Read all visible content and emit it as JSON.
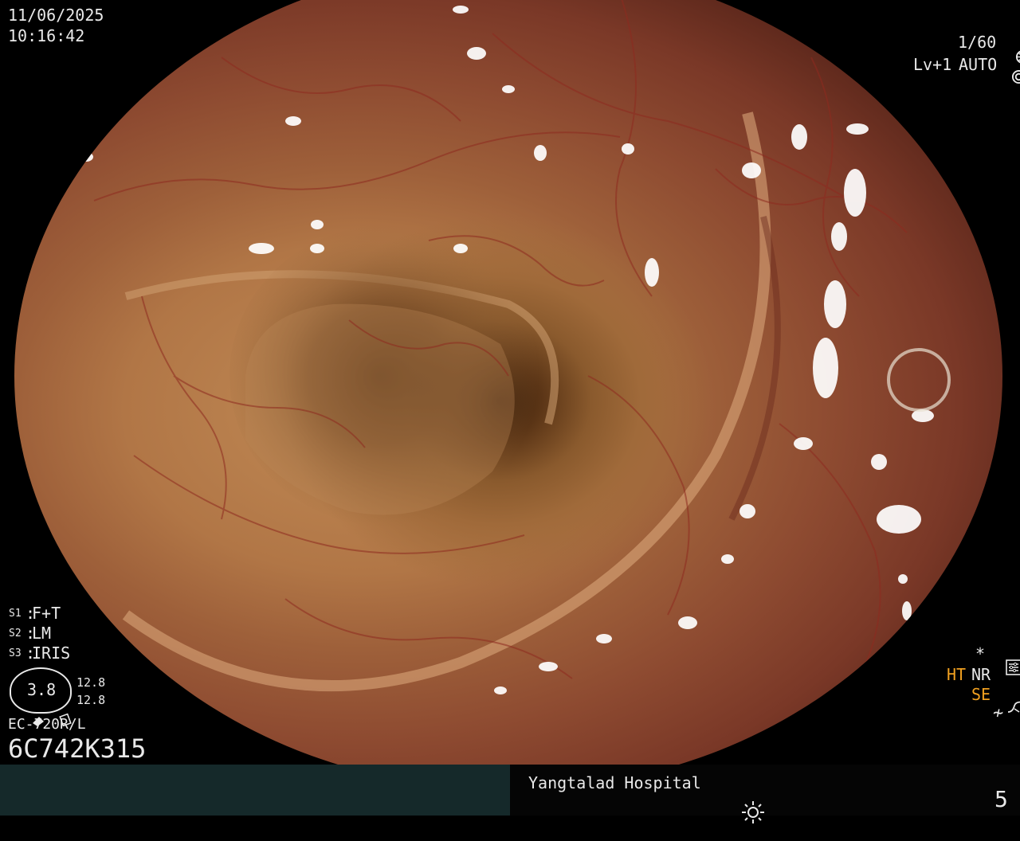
{
  "timestamp": {
    "date": "11/06/2025",
    "time": "10:16:42"
  },
  "camera": {
    "shutter": "1/60",
    "level": "Lv+1",
    "iris_mode": "AUTO"
  },
  "settings": {
    "s1": {
      "key": "S1",
      "value": "F+T"
    },
    "s2": {
      "key": "S2",
      "value": "LM"
    },
    "s3": {
      "key": "S3",
      "value": "IRIS"
    }
  },
  "scope": {
    "gauge_value": "3.8",
    "side_top": "12.8",
    "side_bottom": "12.8",
    "model": "EC-720R/L",
    "serial": "6C742K315"
  },
  "right_indicators": {
    "asterisk": "*",
    "ht": "HT",
    "nr": "NR",
    "se": "SE",
    "extra_symbol": "≁"
  },
  "footer": {
    "hospital": "Yangtalad Hospital",
    "number": "5"
  },
  "colors": {
    "accent_orange": "#f0a020",
    "osd_text": "#e9e9e9",
    "footer_left": "#15292a",
    "footer_right": "#050505"
  },
  "icons": [
    "shutter-icon",
    "iris-auto-icon",
    "settings-list-icon",
    "se-curve-icon",
    "brightness-icon"
  ]
}
